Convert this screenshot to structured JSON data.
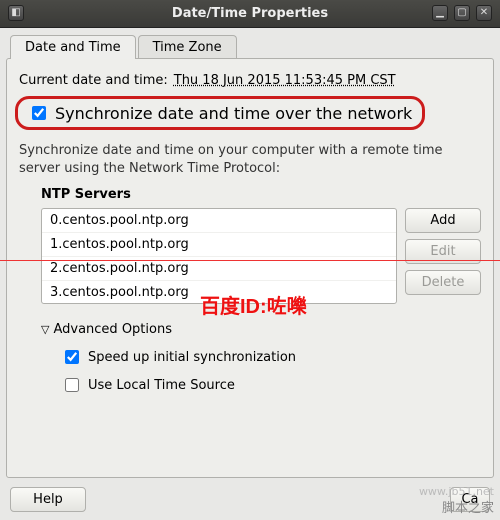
{
  "window": {
    "title": "Date/Time Properties"
  },
  "tabs": [
    {
      "label": "Date and Time",
      "active": true
    },
    {
      "label": "Time Zone",
      "active": false
    }
  ],
  "current": {
    "label": "Current date and time:",
    "value": "Thu 18 Jun 2015 11:53:45 PM CST"
  },
  "sync_checkbox": {
    "label": "Synchronize date and time over the network",
    "checked": true
  },
  "description": "Synchronize date and time on your computer with a remote time server using the Network Time Protocol:",
  "ntp": {
    "header": "NTP Servers",
    "servers": [
      "0.centos.pool.ntp.org",
      "1.centos.pool.ntp.org",
      "2.centos.pool.ntp.org",
      "3.centos.pool.ntp.org"
    ],
    "buttons": {
      "add": "Add",
      "edit": "Edit",
      "delete": "Delete"
    }
  },
  "advanced": {
    "label": "Advanced Options",
    "expanded": true,
    "speed_up": {
      "label": "Speed up initial synchronization",
      "checked": true
    },
    "local_time": {
      "label": "Use Local Time Source",
      "checked": false
    }
  },
  "footer": {
    "help": "Help",
    "cancel": "Cancel"
  },
  "overlay": {
    "text": "百度ID:咗嚛"
  },
  "watermark": {
    "en": "www.jb51.net",
    "cn": "脚本之家"
  }
}
